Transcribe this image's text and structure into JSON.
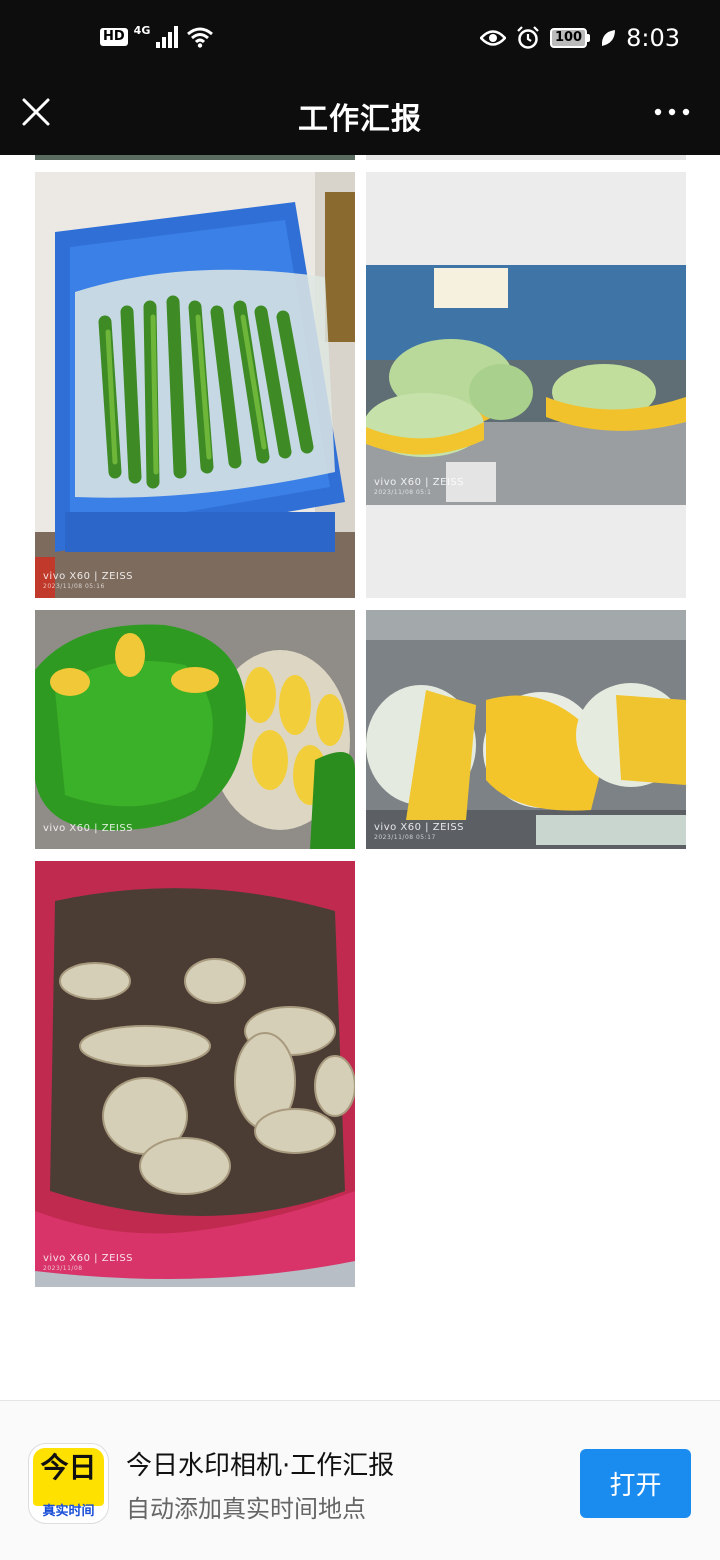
{
  "status_bar": {
    "hd": "HD",
    "network": "4G",
    "battery": "100",
    "time": "8:03"
  },
  "nav": {
    "title": "工作汇报"
  },
  "photos": [
    {
      "camera": "vivo X60 | ZEISS",
      "stamp": "2023/11/08 05:16"
    },
    {
      "camera": "vivo X60 | ZEISS",
      "stamp": "2023/11/08 05:1"
    },
    {
      "camera": "vivo X60 | ZEISS",
      "stamp": ""
    },
    {
      "camera": "vivo X60 | ZEISS",
      "stamp": "2023/11/08 05:17"
    },
    {
      "camera": "vivo X60 | ZEISS",
      "stamp": "2023/11/08"
    }
  ],
  "banner": {
    "icon_text_top": "今日",
    "icon_text_bottom": "真实时间",
    "app_name": "今日水印相机·工作汇报",
    "app_desc": "自动添加真实时间地点",
    "open_label": "打开"
  },
  "colors": {
    "bar_bg": "#0d0d0d",
    "accent": "#1a8cf0",
    "icon_yellow": "#ffe100"
  }
}
